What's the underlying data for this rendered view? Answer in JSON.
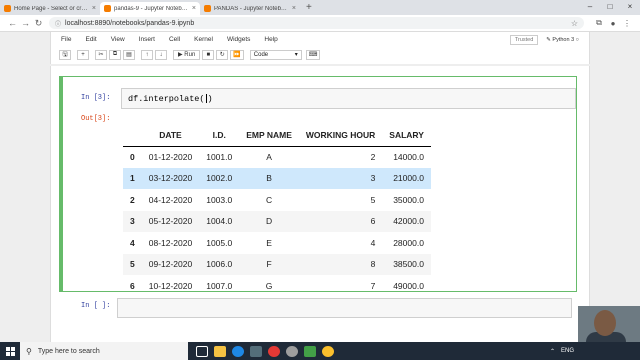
{
  "browser": {
    "tabs": [
      {
        "title": "Home Page - Select or create a no",
        "color": "#f57c00",
        "active": false
      },
      {
        "title": "pandas-9 - Jupyter Notebook",
        "color": "#f57c00",
        "active": true
      },
      {
        "title": "PANDAS - Jupyter Notebook",
        "color": "#f57c00",
        "active": false
      }
    ],
    "new_tab": "+",
    "url": "localhost:8890/notebooks/pandas-9.ipynb"
  },
  "jupyter": {
    "menu": [
      "File",
      "Edit",
      "View",
      "Insert",
      "Cell",
      "Kernel",
      "Widgets",
      "Help"
    ],
    "trusted": "Trusted",
    "kernel_name": "Python 3",
    "run_label": "Run",
    "cell_type": "Code"
  },
  "cell1": {
    "in_prompt": "In [3]:",
    "code_before": "df.interpolate(",
    "code_after": ")",
    "out_prompt": "Out[3]:"
  },
  "table": {
    "columns": [
      "",
      "DATE",
      "I.D.",
      "EMP NAME",
      "WORKING HOUR",
      "SALARY"
    ],
    "rows": [
      [
        "0",
        "01-12-2020",
        "1001.0",
        "A",
        "2",
        "14000.0"
      ],
      [
        "1",
        "03-12-2020",
        "1002.0",
        "B",
        "3",
        "21000.0"
      ],
      [
        "2",
        "04-12-2020",
        "1003.0",
        "C",
        "5",
        "35000.0"
      ],
      [
        "3",
        "05-12-2020",
        "1004.0",
        "D",
        "6",
        "42000.0"
      ],
      [
        "4",
        "08-12-2020",
        "1005.0",
        "E",
        "4",
        "28000.0"
      ],
      [
        "5",
        "09-12-2020",
        "1006.0",
        "F",
        "8",
        "38500.0"
      ],
      [
        "6",
        "10-12-2020",
        "1007.0",
        "G",
        "7",
        "49000.0"
      ]
    ]
  },
  "cell2": {
    "in_prompt": "In [ ]:"
  },
  "taskbar": {
    "search_placeholder": "Type here to search",
    "tray_lang": "ENG"
  }
}
